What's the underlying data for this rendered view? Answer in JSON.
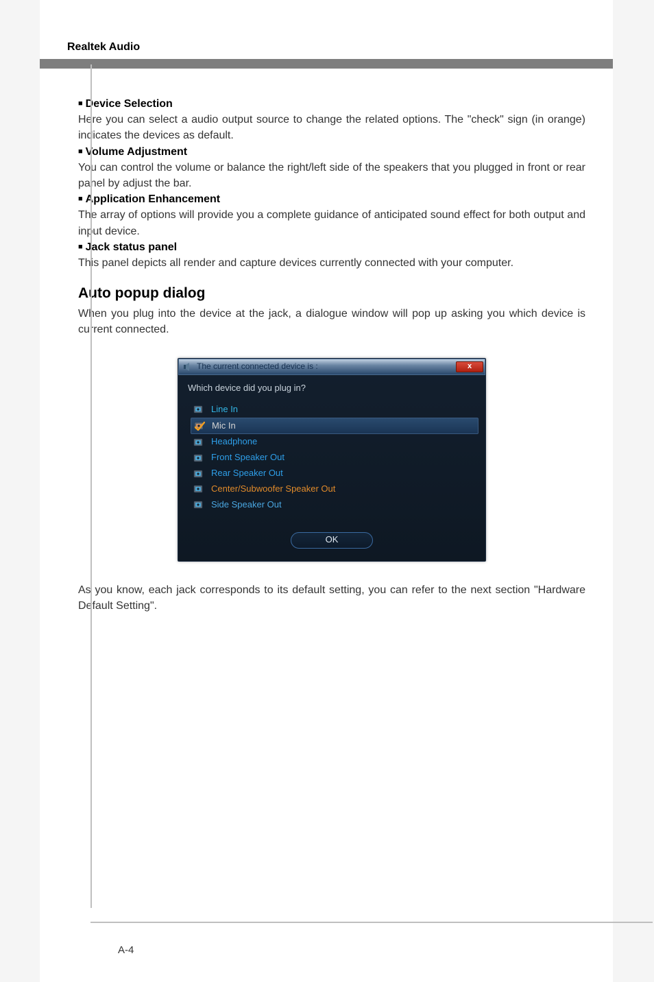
{
  "header": {
    "title": "Realtek Audio"
  },
  "sections": {
    "device_selection": {
      "heading": "Device Selection",
      "body": "Here you can select a audio output source to change the related options. The \"check\" sign (in orange) indicates the devices as default."
    },
    "volume_adjustment": {
      "heading": "Volume Adjustment",
      "body": "You can control the volume or balance the right/left side of the speakers that you plugged in front or rear panel by adjust the bar."
    },
    "application_enhancement": {
      "heading": "Application Enhancement",
      "body": "The array of options will provide you a complete guidance of anticipated sound effect for both output and input device."
    },
    "jack_status": {
      "heading": "Jack status panel",
      "body": "This panel depicts all render and capture devices currently connected with your computer."
    },
    "auto_popup": {
      "title": "Auto popup dialog",
      "body": "When you plug into the device at the jack, a dialogue window will pop up asking you which device is current connected."
    },
    "footnote": "As you know, each jack corresponds to its default setting, you can refer to the next section \"Hardware Default Setting\"."
  },
  "dialog": {
    "title": "The current connected device is :",
    "prompt": "Which device did you plug in?",
    "close_label": "x",
    "ok_label": "OK",
    "devices": [
      {
        "label": "Line In",
        "class": "c-linein",
        "fill": "#4aa6d6",
        "selected": false
      },
      {
        "label": "Mic In",
        "class": "c-micin",
        "fill": "#d09060",
        "selected": true,
        "checked": true
      },
      {
        "label": "Headphone",
        "class": "c-headphone",
        "fill": "#4aa6d6",
        "selected": false
      },
      {
        "label": "Front Speaker Out",
        "class": "c-front",
        "fill": "#4aa6d6",
        "selected": false
      },
      {
        "label": "Rear Speaker Out",
        "class": "c-rear",
        "fill": "#4aa6d6",
        "selected": false
      },
      {
        "label": "Center/Subwoofer Speaker Out",
        "class": "c-center",
        "fill": "#4aa6d6",
        "selected": false
      },
      {
        "label": "Side Speaker Out",
        "class": "c-side",
        "fill": "#4aa6d6",
        "selected": false
      }
    ]
  },
  "page_number": "A-4"
}
